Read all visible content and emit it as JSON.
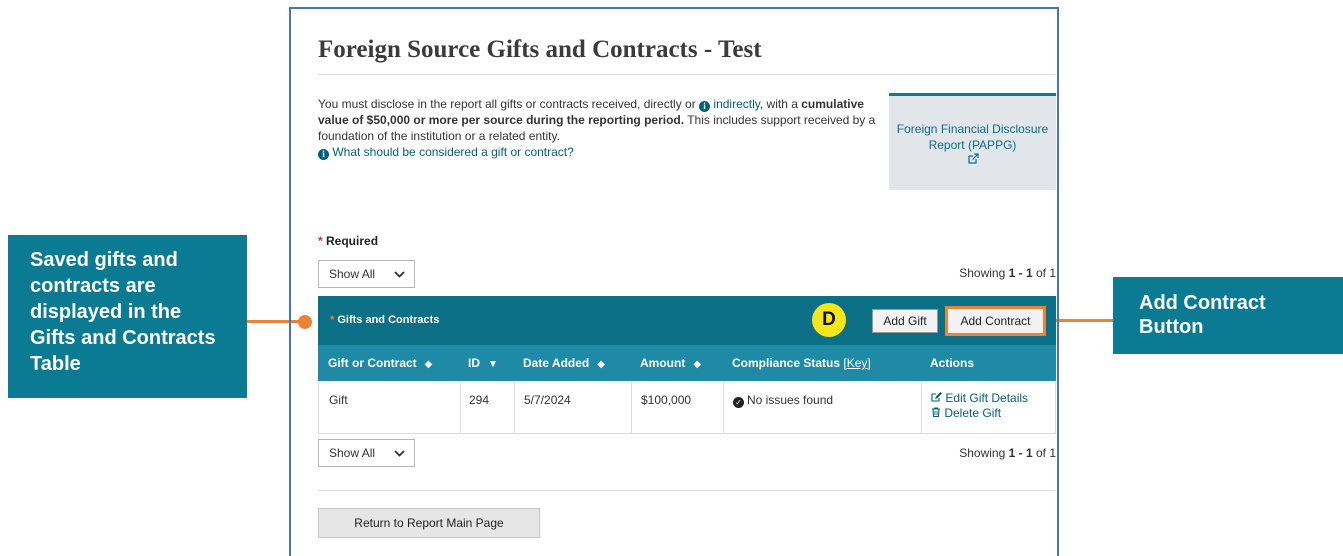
{
  "callouts": {
    "left_text": "Saved gifts and contracts are displayed in the Gifts and Contracts Table",
    "right_text": "Add Contract Button",
    "badge": "D"
  },
  "page": {
    "title": "Foreign Source Gifts and Contracts - Test",
    "intro_part1": "You must disclose in the report all gifts or contracts received, directly or ",
    "intro_link": "indirectly",
    "intro_part2": ", with a ",
    "intro_bold": "cumulative value of $50,000 or more per source during the reporting period.",
    "intro_part3": " This includes support received by a foundation of the institution or a related entity.",
    "help_link": "What should be considered a gift or contract?",
    "report_card_label": "Foreign Financial Disclosure Report (PAPPG)",
    "required_label": "Required"
  },
  "pager_top": {
    "select_value": "Show All",
    "showing_prefix": "Showing ",
    "showing_range": "1 - 1",
    "showing_suffix": " of 1"
  },
  "pager_bottom": {
    "select_value": "Show All",
    "showing_prefix": "Showing ",
    "showing_range": "1 - 1",
    "showing_suffix": " of 1"
  },
  "table": {
    "title": "Gifts and Contracts",
    "add_gift_label": "Add Gift",
    "add_contract_label": "Add Contract",
    "headers": {
      "type": "Gift or Contract",
      "id": "ID",
      "date": "Date Added",
      "amount": "Amount",
      "compliance": "Compliance Status",
      "compliance_key": "[Key]",
      "actions": "Actions"
    },
    "rows": [
      {
        "type": "Gift",
        "id": "294",
        "date": "5/7/2024",
        "amount": "$100,000",
        "compliance": "No issues found",
        "edit_label": "Edit Gift Details",
        "delete_label": "Delete Gift"
      }
    ]
  },
  "footer": {
    "return_label": "Return to Report Main Page"
  },
  "colors": {
    "teal_dark": "#0b6f86",
    "teal_header": "#1e8aa5",
    "callout": "#0b7b94",
    "highlight_orange": "#e8833a",
    "badge_yellow": "#f5e617"
  }
}
